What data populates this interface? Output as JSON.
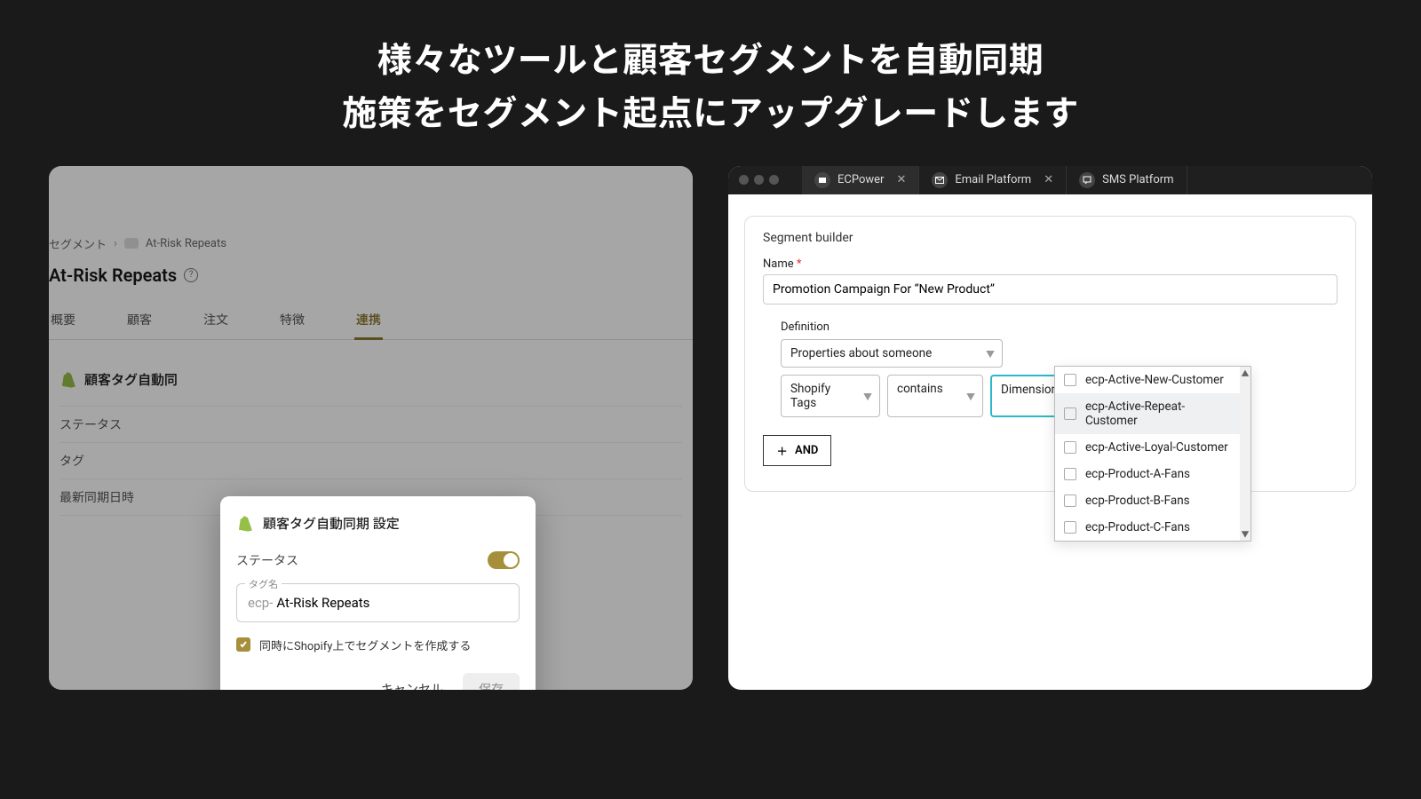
{
  "hero": {
    "line1": "様々なツールと顧客セグメントを自動同期",
    "line2": "施策をセグメント起点にアップグレードします"
  },
  "left": {
    "breadcrumb_root": "セグメント",
    "breadcrumb_leaf": "At-Risk Repeats",
    "title": "At-Risk Repeats",
    "tabs": [
      "概要",
      "顧客",
      "注文",
      "特徴",
      "連携"
    ],
    "active_tab": 4,
    "sync_heading": "顧客タグ自動同",
    "rows": [
      "ステータス",
      "タグ",
      "最新同期日時"
    ],
    "modal": {
      "title": "顧客タグ自動同期 設定",
      "status_label": "ステータス",
      "tag_label": "タグ名",
      "prefix": "ecp-",
      "tag_value": "At-Risk Repeats",
      "checkbox_label": "同時にShopify上でセグメントを作成する",
      "cancel": "キャンセル",
      "save": "保存"
    }
  },
  "right": {
    "tabs": [
      {
        "label": "ECPower",
        "close": true
      },
      {
        "label": "Email Platform",
        "close": true
      },
      {
        "label": "SMS Platform",
        "close": false
      }
    ],
    "builder": {
      "title": "Segment builder",
      "name_label": "Name",
      "name_value": "Promotion Campaign For “New Product”",
      "definition_label": "Definition",
      "prop_select": "Properties about someone",
      "field_select": "Shopify Tags",
      "op_select": "contains",
      "dim_placeholder": "Dimension Value",
      "and_label": "AND",
      "options": [
        "ecp-Active-New-Customer",
        "ecp-Active-Repeat-Customer",
        "ecp-Active-Loyal-Customer",
        "ecp-Product-A-Fans",
        "ecp-Product-B-Fans",
        "ecp-Product-C-Fans"
      ],
      "hover_index": 1
    }
  }
}
